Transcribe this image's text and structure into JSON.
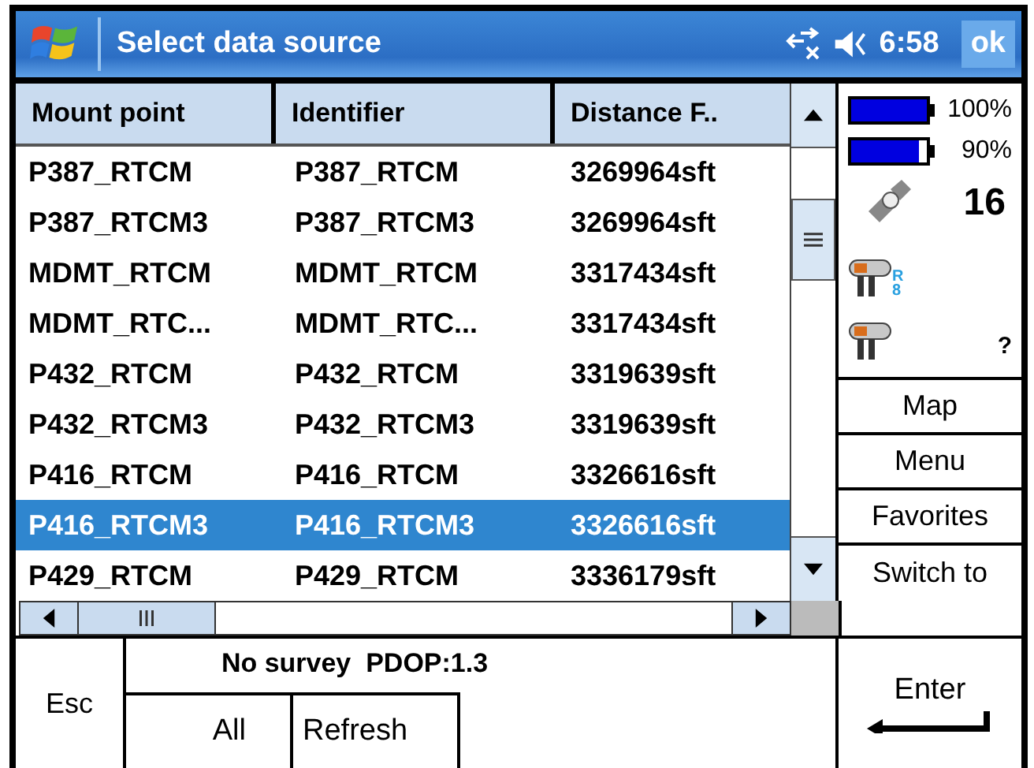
{
  "title_bar": {
    "title": "Select data source",
    "time": "6:58",
    "ok": "ok"
  },
  "table": {
    "columns": [
      "Mount point",
      "Identifier",
      "Distance F.."
    ],
    "rows": [
      {
        "cells": [
          "P387_RTCM",
          "P387_RTCM",
          "3269964sft"
        ],
        "selected": false
      },
      {
        "cells": [
          "P387_RTCM3",
          "P387_RTCM3",
          "3269964sft"
        ],
        "selected": false
      },
      {
        "cells": [
          "MDMT_RTCM",
          "MDMT_RTCM",
          "3317434sft"
        ],
        "selected": false
      },
      {
        "cells": [
          "MDMT_RTC...",
          "MDMT_RTC...",
          "3317434sft"
        ],
        "selected": false
      },
      {
        "cells": [
          "P432_RTCM",
          "P432_RTCM",
          "3319639sft"
        ],
        "selected": false
      },
      {
        "cells": [
          "P432_RTCM3",
          "P432_RTCM3",
          "3319639sft"
        ],
        "selected": false
      },
      {
        "cells": [
          "P416_RTCM",
          "P416_RTCM",
          "3326616sft"
        ],
        "selected": false
      },
      {
        "cells": [
          "P416_RTCM3",
          "P416_RTCM3",
          "3326616sft"
        ],
        "selected": true
      },
      {
        "cells": [
          "P429_RTCM",
          "P429_RTCM",
          "3336179sft"
        ],
        "selected": false
      }
    ]
  },
  "status_panel": {
    "batteries": [
      {
        "level": 1.0,
        "reading": "100%"
      },
      {
        "level": 0.9,
        "reading": "90%"
      }
    ],
    "satellites": "16",
    "receivers": [
      {
        "badge": "R\n8"
      },
      {
        "badge": "?"
      }
    ]
  },
  "side_buttons": [
    "Map",
    "Menu",
    "Favorites",
    "Switch to"
  ],
  "bottom": {
    "esc": "Esc",
    "status": "No survey  PDOP:1.3",
    "filters": [
      "All",
      "Refresh"
    ],
    "enter": "Enter"
  }
}
